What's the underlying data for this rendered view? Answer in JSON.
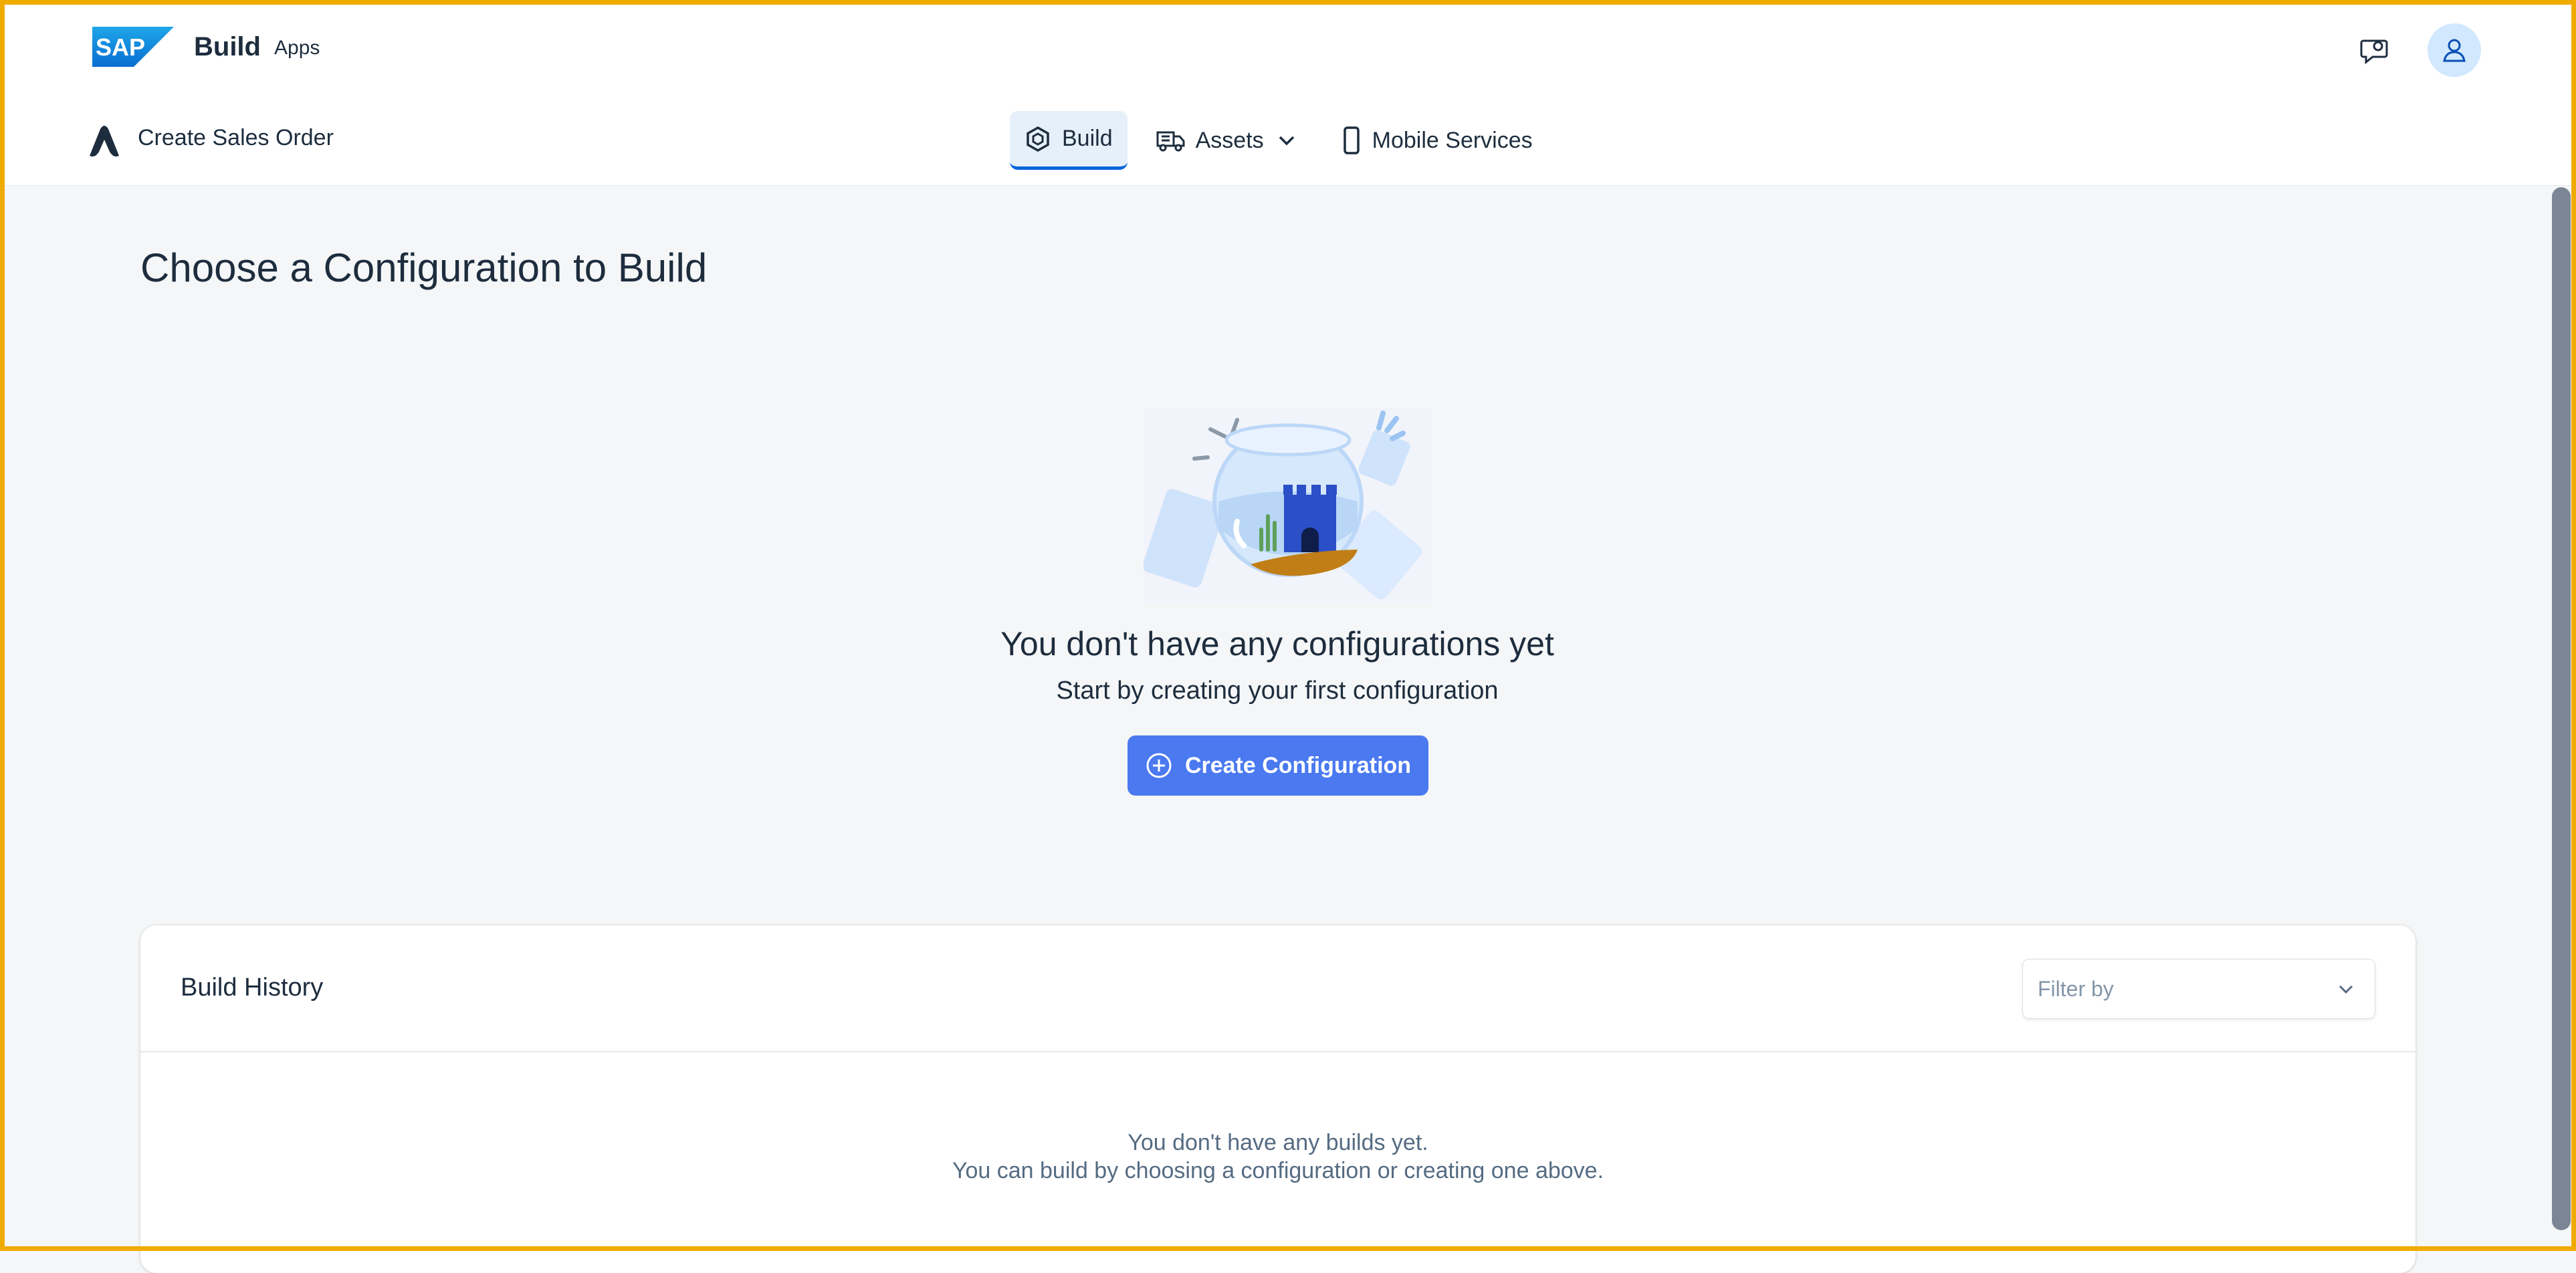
{
  "shellbar": {
    "logo_text": "SAP",
    "product": "Build",
    "product_sub": "Apps",
    "feedback_icon": "feedback-icon",
    "avatar_icon": "user-icon"
  },
  "appbar": {
    "app_name": "Create Sales Order",
    "tabs": [
      {
        "label": "Build",
        "icon": "build-icon",
        "active": true
      },
      {
        "label": "Assets",
        "icon": "truck-icon",
        "active": false
      },
      {
        "label": "Mobile Services",
        "icon": "mobile-icon",
        "active": false
      }
    ]
  },
  "main": {
    "page_title": "Choose a Configuration to Build",
    "empty_title": "You don't have any configurations yet",
    "empty_subtitle": "Start by creating your first configuration",
    "create_button": "Create Configuration"
  },
  "history": {
    "title": "Build History",
    "filter_placeholder": "Filter by",
    "empty_line1": "You don't have any builds yet.",
    "empty_line2": "You can build by choosing a configuration or creating one above."
  },
  "colors": {
    "accent": "#0064d9",
    "button": "#4a79f0",
    "frame": "#f0ab00"
  }
}
